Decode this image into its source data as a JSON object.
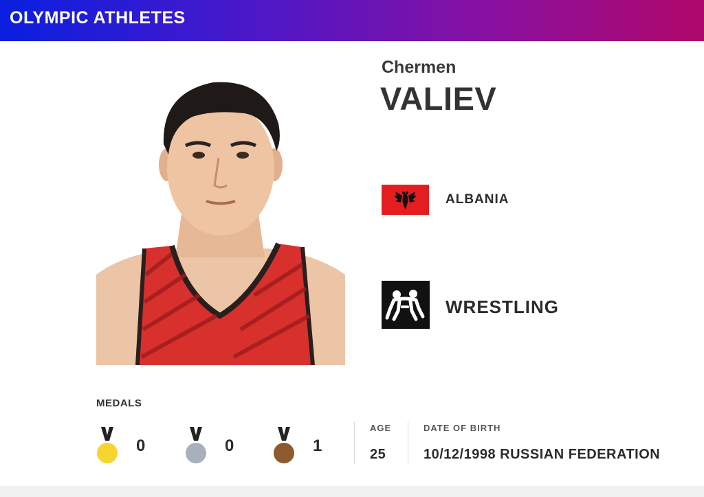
{
  "header": {
    "title": "OLYMPIC ATHLETES"
  },
  "athlete": {
    "first_name": "Chermen",
    "last_name": "VALIEV",
    "country": "ALBANIA",
    "sport": "WRESTLING"
  },
  "medals": {
    "label": "MEDALS",
    "gold": "0",
    "silver": "0",
    "bronze": "1"
  },
  "stats": {
    "age_label": "AGE",
    "age": "25",
    "dob_label": "DATE OF BIRTH",
    "dob": "10/12/1998 RUSSIAN FEDERATION"
  },
  "icons": {
    "flag": "albania-flag-icon",
    "sport": "wrestling-icon",
    "gold": "gold-medal-icon",
    "silver": "silver-medal-icon",
    "bronze": "bronze-medal-icon"
  },
  "colors": {
    "gold": "#f7d531",
    "silver": "#a8b0bd",
    "bronze": "#8c5a2b",
    "flag_red": "#e41e20"
  }
}
